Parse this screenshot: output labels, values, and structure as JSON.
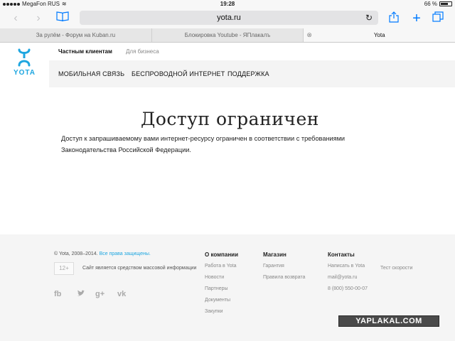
{
  "status_bar": {
    "carrier": "MegaFon RUS",
    "time": "19:28",
    "battery": "66 %"
  },
  "browser": {
    "url": "yota.ru",
    "tabs": [
      {
        "label": "За рулём - Форум на Kuban.ru",
        "active": false
      },
      {
        "label": "Блокировка Youtube - ЯПлакалъ",
        "active": false
      },
      {
        "label": "Yota",
        "active": true
      }
    ]
  },
  "site": {
    "logo_text": "YOTA",
    "subnav": {
      "private": "Частным клиентам",
      "business": "Для бизнеса"
    },
    "nav": {
      "mobile": "МОБИЛЬНАЯ СВЯЗЬ",
      "wireless": "БЕСПРОВОДНОЙ ИНТЕРНЕТ",
      "support": "ПОДДЕРЖКА"
    },
    "accent": "#1ea6e0"
  },
  "content": {
    "title": "Доступ ограничен",
    "text": "Доступ к запрашиваемому вами интернет-ресурсу ограничен в соответствии с требованиями Законодательства Российской Федерации."
  },
  "footer": {
    "copyright": "© Yota, 2008–2014.",
    "rights": "Все права защищены.",
    "age": "12+",
    "mass_media": "Сайт является средством массовой информации",
    "social": [
      {
        "label": "fb",
        "icon": "facebook-icon"
      },
      {
        "label": "t",
        "icon": "twitter-icon"
      },
      {
        "label": "g+",
        "icon": "google-plus-icon"
      },
      {
        "label": "vk",
        "icon": "vk-icon"
      }
    ],
    "about": {
      "heading": "О компании",
      "links": [
        "Работа в Yota",
        "Новости",
        "Партнеры",
        "Документы",
        "Закупки"
      ]
    },
    "shop": {
      "heading": "Магазин",
      "links": [
        "Гарантия",
        "Правила возврата"
      ]
    },
    "contacts": {
      "heading": "Контакты",
      "links": [
        "Написать в Yota",
        "mail@yota.ru",
        "8 (800) 550-00-07"
      ],
      "speed_test": "Тест скорости"
    }
  },
  "watermark": "YAPLAKAL.COM"
}
